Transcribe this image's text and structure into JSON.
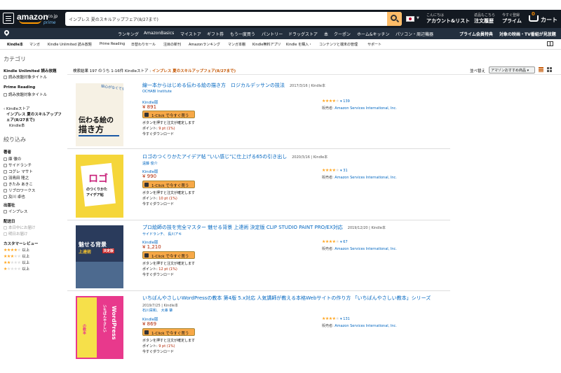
{
  "header": {
    "logo_text": "amazon",
    "logo_tld": ".co.jp",
    "logo_sub": "prime",
    "search_value": "インプレス 夏のスキルアップフェア(8/27まで)",
    "account_small": "こんにちは",
    "account_big": "アカウント&リスト",
    "orders_small": "返品もこちら",
    "orders_big": "注文履歴",
    "prime_small": "今すぐ登録",
    "prime_big": "プライム",
    "cart_count": "0",
    "cart_label": "カート"
  },
  "subnav": {
    "items": [
      "ランキング",
      "AmazonBasics",
      "マイストア",
      "ギフト券",
      "もう一度買う",
      "パントリー",
      "ドラッグストア",
      "本",
      "クーポン",
      "ホーム&キッチン",
      "パソコン・周辺機器"
    ],
    "prime_items": [
      "プライム会員特典",
      "対象の映画・TV番組が見放題"
    ]
  },
  "kindlenav": {
    "items": [
      "Kindle本",
      "マンガ",
      "Kindle Unlimited 読み放題",
      "Prime Reading",
      "日替わりセール",
      "注目の新刊",
      "Amazonランキング",
      "マンガ本棚",
      "Kindle無料アプリ",
      "Kindle を購入・",
      "コンテンツと端末の管理",
      "サポート"
    ]
  },
  "sidebar": {
    "category_heading": "カテゴリ",
    "ku_heading": "Kindle Unlimited 読み放題",
    "ku_option": "読み放題対象タイトル",
    "pr_heading": "Prime Reading",
    "pr_option": "読み放題対象タイトル",
    "store_back": "‹ Kindleストア",
    "store_current_1": "インプレス 夏のスキルアップフ",
    "store_current_2": "ェア(8/27まで)",
    "store_child": "Kindle本",
    "refine_heading": "絞り込み",
    "author_heading": "著者",
    "authors": [
      "庫 徹の",
      "サイドランチ",
      "コグレ マサト",
      "羽鳥田 隆之",
      "きたみ あきこ",
      "リブロワークス",
      "及川 卓也"
    ],
    "publisher_heading": "出版社",
    "publishers": [
      "インプレス"
    ],
    "release_heading": "配送日",
    "release_options": [
      "本日中にお届け",
      "明日お届け"
    ],
    "review_heading": "カスタマーレビュー",
    "review_options": [
      {
        "filled": 4,
        "label": "以上"
      },
      {
        "filled": 3,
        "label": "以上"
      },
      {
        "filled": 2,
        "label": "以上"
      },
      {
        "filled": 1,
        "label": "以上"
      }
    ]
  },
  "results_bar": {
    "count_text": "検索結果 197 のうち 1-16件 Kindleストア : ",
    "keyword": "インプレス 夏のスキルアップフェア(8/27まで)",
    "sort_label": "並べ替え",
    "sort_value": "アマゾンおすすめ商品"
  },
  "results": [
    {
      "title": "線一本からはじめる伝わる絵の描き方　ロジカルデッサンの技法",
      "meta": "2017/3/16 | Kindle本",
      "author": "OCHABI Institute",
      "format": "Kindle版",
      "price": "¥ 891",
      "button": "1-Click で今すぐ買う",
      "note": "ボタンを押すと注文が確定します",
      "points_label": "ポイント: ",
      "points_value": "9 pt (1%)",
      "download": "今すぐダウンロード",
      "stars": 4.5,
      "review_count": "139",
      "seller_label": "販売者: ",
      "seller": "Amazon Services International, Inc.",
      "cover": {
        "bg": "#f6f1e4",
        "accent": "#1c5aa6",
        "title_lines": [
          "伝わる絵の",
          "描き方"
        ],
        "tag": "絵心がなくても描ける!"
      }
    },
    {
      "title": "ロゴのつくりかたアイデア帖 \"いい感じ\"に仕上げる65の引き出し",
      "meta": "2020/3/16 | Kindle本",
      "author": "遠藤 俊介",
      "format": "Kindle版",
      "price": "¥ 990",
      "button": "1-Click で今すぐ買う",
      "note": "ボタンを押すと注文が確定します",
      "points_label": "ポイント: ",
      "points_value": "10 pt (1%)",
      "download": "今すぐダウンロード",
      "stars": 4.5,
      "review_count": "31",
      "seller_label": "販売者: ",
      "seller": "Amazon Services International, Inc.",
      "cover": {
        "bg": "#f5d63a",
        "accent": "#c81e78",
        "title_lines": [
          "ロゴ",
          "のつくりかた"
        ],
        "tag": "アイデア帖"
      }
    },
    {
      "title": "プロ絵師の技を完全マスター 魅せる背景 上達術 決定版 CLIP STUDIO PAINT PRO/EX対応",
      "meta": "2019/12/20 | Kindle本",
      "author": "サイドランチ、 長川アキ",
      "format": "Kindle版",
      "price": "¥ 1,210",
      "button": "1-Click で今すぐ買う",
      "note": "ボタンを押すと注文が確定します",
      "points_label": "ポイント: ",
      "points_value": "12 pt (1%)",
      "download": "今すぐダウンロード",
      "stars": 4.5,
      "review_count": "67",
      "seller_label": "販売者: ",
      "seller": "Amazon Services International, Inc.",
      "cover": {
        "bg": "#2a3b5c",
        "accent": "#f2c12e",
        "title_lines": [
          "魅せる背景",
          "上達術"
        ],
        "tag": "決定版"
      }
    },
    {
      "title": "いちばんやさしいWordPressの教本 第4版 5.x対応 人気講師が教える本格Webサイトの作り方 「いちばんやさしい教本」シリーズ",
      "meta": "2019/7/25 | Kindle本",
      "author": "石川栄和、 大串 肇",
      "format": "Kindle版",
      "price": "¥ 869",
      "button": "1-Click で今すぐ買う",
      "note": "ボタンを押すと注文が確定します",
      "points_label": "ポイント: ",
      "points_value": "9 pt (1%)",
      "download": "今すぐダウンロード",
      "stars": 4.0,
      "review_count": "131",
      "seller_label": "販売者: ",
      "seller": "Amazon Services International, Inc.",
      "cover": {
        "bg": "#e8398c",
        "accent": "#f6e04a",
        "title_lines": [
          "WordPress",
          "の教本"
        ],
        "tag": "いちばんやさしい"
      }
    }
  ],
  "colors": {
    "nav_bg": "#131921",
    "subnav_bg": "#232f3e",
    "search_btn": "#febd69",
    "link": "#0066c0",
    "price": "#b12704",
    "star": "#ffa41c",
    "buy_btn": "#f7a847"
  },
  "icons": [
    "menu-icon",
    "search-icon",
    "japan-flag-icon",
    "cart-icon",
    "location-icon",
    "kindle-book-icon",
    "list-view-icon",
    "grid-view-icon",
    "one-click-icon"
  ]
}
